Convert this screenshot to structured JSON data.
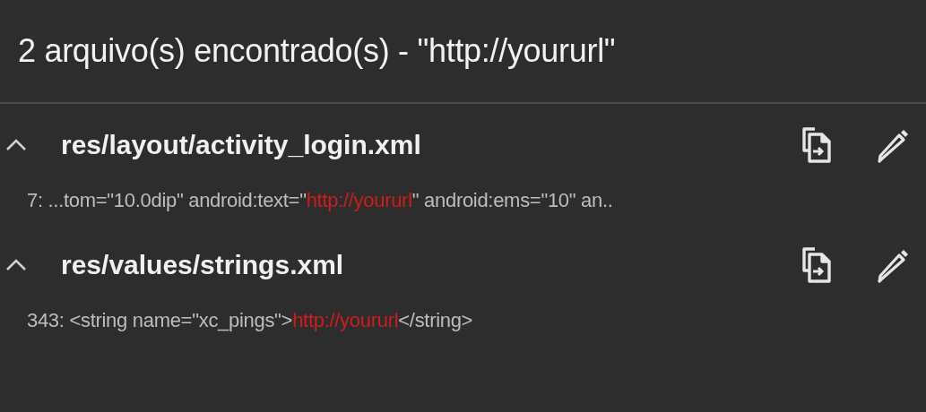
{
  "header": {
    "title": "2 arquivo(s) encontrado(s) - \"http://yoururl\""
  },
  "files": [
    {
      "path": "res/layout/activity_login.xml",
      "expanded": true,
      "results": [
        {
          "prefix": "7: ...tom=\"10.0dip\" android:text=\"",
          "match": "http://yoururl",
          "suffix": "\" android:ems=\"10\" an.."
        }
      ]
    },
    {
      "path": "res/values/strings.xml",
      "expanded": true,
      "results": [
        {
          "prefix": "343: <string name=\"xc_pings\">",
          "match": "http://yoururl",
          "suffix": "</string>"
        }
      ]
    }
  ]
}
